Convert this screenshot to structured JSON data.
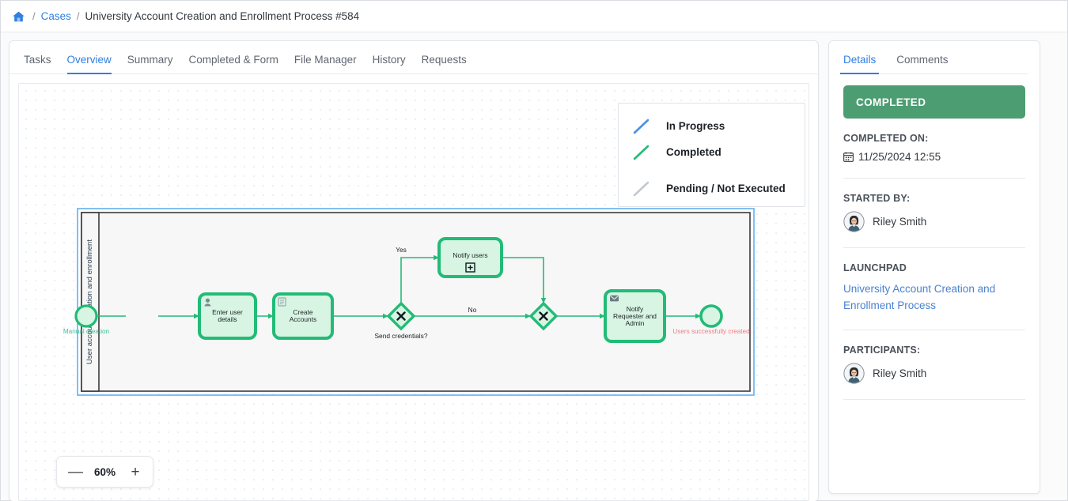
{
  "breadcrumb": {
    "home_icon": "home-icon",
    "separator": "/",
    "cases_label": "Cases",
    "current_label": "University Account Creation and Enrollment Process #584"
  },
  "main": {
    "tabs": [
      {
        "label": "Tasks",
        "active": false
      },
      {
        "label": "Overview",
        "active": true
      },
      {
        "label": "Summary",
        "active": false
      },
      {
        "label": "Completed & Form",
        "active": false
      },
      {
        "label": "File Manager",
        "active": false
      },
      {
        "label": "History",
        "active": false
      },
      {
        "label": "Requests",
        "active": false
      }
    ],
    "legend": [
      {
        "label": "In Progress",
        "color": "#4a90e2"
      },
      {
        "label": "Completed",
        "color": "#22bb77"
      },
      {
        "label": "Pending / Not Executed",
        "color": "#c4c9ce"
      }
    ],
    "zoom": {
      "minus_label": "—",
      "value": "60%",
      "plus_label": "+"
    }
  },
  "diagram": {
    "lane_label": "User account creation and enrollment",
    "start_event": {
      "label": "Manual creation"
    },
    "tasks": [
      {
        "id": "enter-user-details",
        "label": "Enter user details",
        "icon": "user-task-icon"
      },
      {
        "id": "create-accounts",
        "label": "Create Accounts",
        "icon": "script-task-icon"
      },
      {
        "id": "notify-users",
        "label": "Notify users",
        "icon": "subprocess-plus-icon"
      },
      {
        "id": "notify-requester-admin",
        "label": "Notify Requester and Admin",
        "icon": "send-task-icon"
      }
    ],
    "gateways": [
      {
        "id": "send-credentials",
        "label": "Send credentials?",
        "type": "exclusive"
      },
      {
        "id": "merge",
        "label": "",
        "type": "exclusive"
      }
    ],
    "flow_labels": [
      {
        "id": "yes",
        "label": "Yes"
      },
      {
        "id": "no",
        "label": "No"
      }
    ],
    "end_event": {
      "label": "Users successfully created"
    },
    "colors": {
      "completed_stroke": "#22bb77",
      "task_fill": "#d8f5e3",
      "start_label": "#3fbf96",
      "end_label": "#f47a83"
    }
  },
  "sidebar": {
    "tabs": [
      {
        "label": "Details",
        "active": true
      },
      {
        "label": "Comments",
        "active": false
      }
    ],
    "status": "COMPLETED",
    "completed_on_label": "COMPLETED ON:",
    "completed_on_value": "11/25/2024 12:55",
    "calendar_icon": "calendar-icon",
    "started_by_label": "STARTED BY:",
    "started_by_name": "Riley Smith",
    "launchpad_label": "LAUNCHPAD",
    "launchpad_link": "University Account Creation and Enrollment Process",
    "participants_label": "PARTICIPANTS:",
    "participants": [
      {
        "name": "Riley Smith"
      }
    ]
  }
}
